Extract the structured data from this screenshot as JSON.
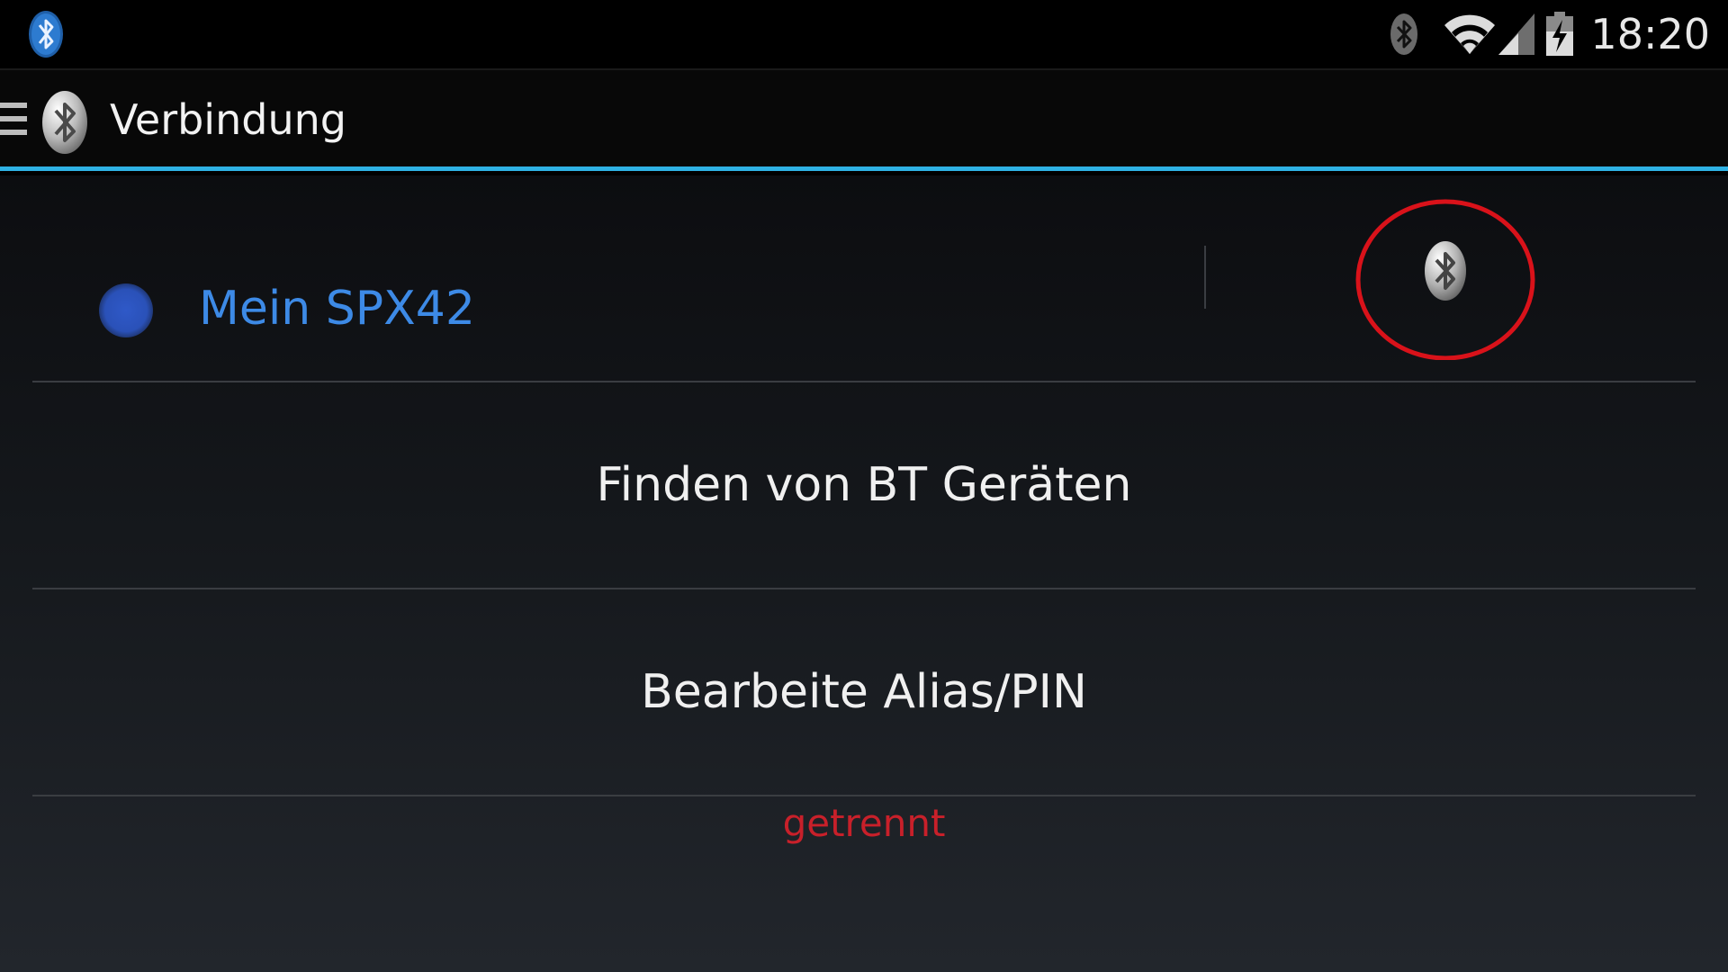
{
  "status_bar": {
    "time": "18:20",
    "icons": [
      "bluetooth-app-icon",
      "bluetooth-icon",
      "wifi-icon",
      "signal-icon",
      "battery-charging-icon"
    ]
  },
  "action_bar": {
    "title": "Verbindung",
    "accent_color": "#2fb2e4"
  },
  "device": {
    "name": "Mein SPX42",
    "name_color": "#3d8ae6",
    "indicator_color": "#2f59c8"
  },
  "menu": {
    "discover_label": "Finden von BT Geräten",
    "edit_label": "Bearbeite Alias/PIN"
  },
  "connection_status": {
    "text": "getrennt",
    "color": "#c8202a"
  }
}
